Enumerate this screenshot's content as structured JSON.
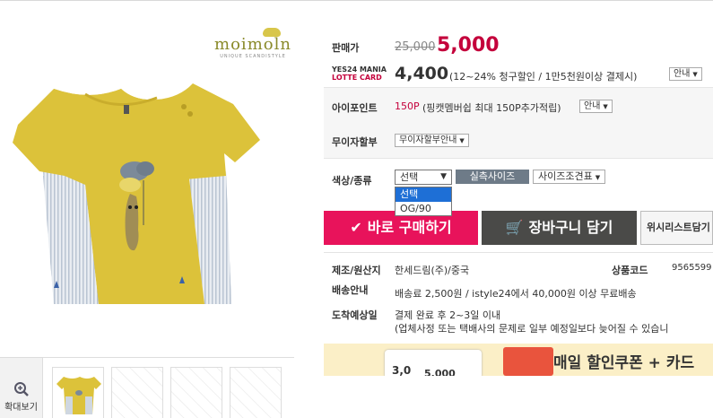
{
  "brand": {
    "name": "moimoln",
    "tagline": "UNIQUE SCANDISTYLE"
  },
  "thumbs": {
    "zoom_label": "확대보기"
  },
  "price": {
    "label": "판매가",
    "original": "25,000",
    "sale": "5,000"
  },
  "card": {
    "logo_line1": "YES24 MANIA",
    "logo_line2": "LOTTE CARD",
    "price": "4,400",
    "desc": "(12~24% 청구할인 / 1만5천원이상 결제시)",
    "info_button": "안내"
  },
  "points": {
    "label": "아이포인트",
    "value": "150P",
    "desc": "(핑캣멤버쉽 최대 150P추가적립)",
    "info_button": "안내"
  },
  "installment": {
    "label": "무이자할부",
    "button": "무이자할부안내"
  },
  "option": {
    "label": "색상/종류",
    "selected": "선택",
    "options": [
      "선택",
      "OG/90"
    ],
    "size_button": "실측사이즈",
    "size_chart_button": "사이즈조견표"
  },
  "actions": {
    "buy": "바로 구매하기",
    "cart": "장바구니 담기",
    "wishlist": "위시리스트담기"
  },
  "details": {
    "maker_label": "제조/원산지",
    "maker_value": "한세드림(주)/중국",
    "code_label": "상품코드",
    "code_value": "9565599",
    "shipping_label": "배송안내",
    "shipping_value": "배송료 2,500원 / istyle24에서 40,000원 이상 무료배송",
    "arrival_label": "도착예상일",
    "arrival_value": "결제 완료 후 2~3일 이내",
    "arrival_note": "(업체사정 또는 택배사의 문제로 일부 예정일보다 늦어질 수 있습니"
  },
  "banner": {
    "text": "매일 할인쿠폰 + 카드",
    "card_num": "3,0",
    "card_amount": "5,000"
  },
  "colors": {
    "sale": "#c4003b",
    "buy": "#e8135b",
    "cart": "#4a4a48",
    "shirt": "#dcc23a"
  }
}
